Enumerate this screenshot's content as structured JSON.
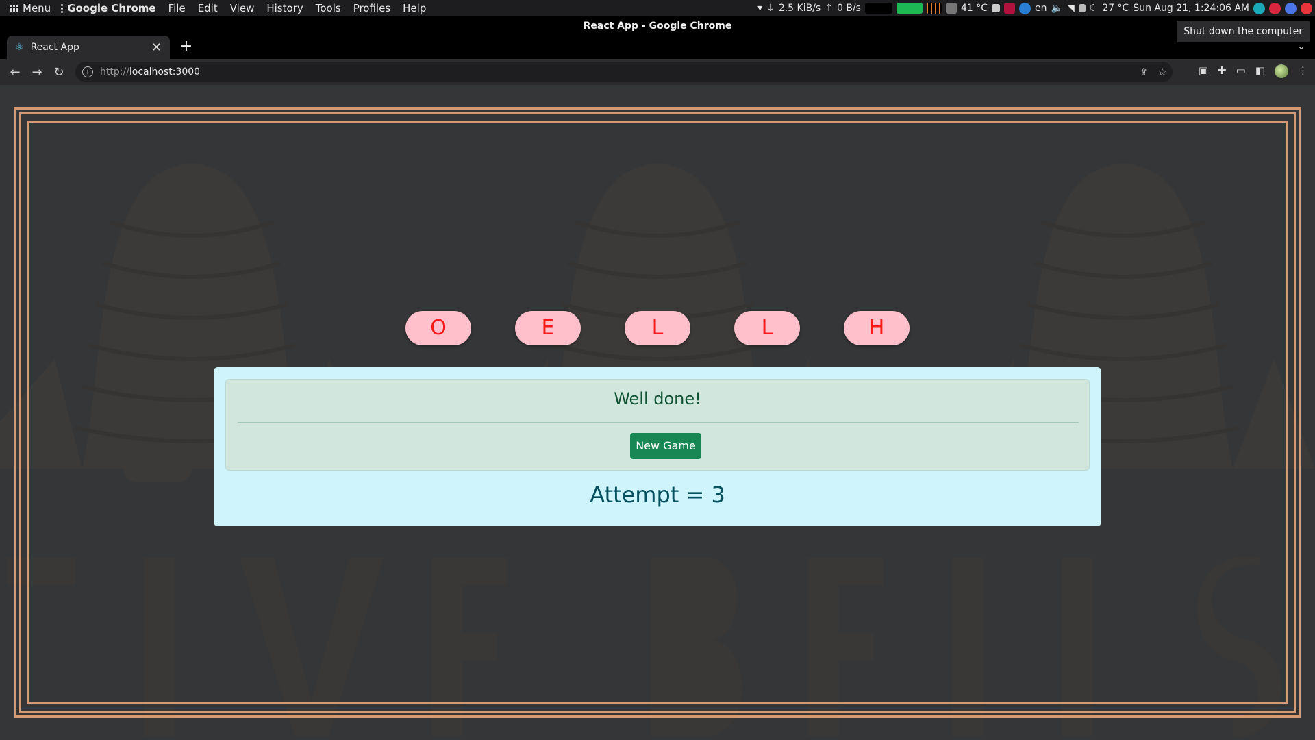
{
  "os_panel": {
    "menu_label": "Menu",
    "app_name": "Google Chrome",
    "menus": [
      "File",
      "Edit",
      "View",
      "History",
      "Tools",
      "Profiles",
      "Help"
    ],
    "net_down": "2.5 KiB/s",
    "net_up": "0 B/s",
    "cpu_temp": "41 °C",
    "keyboard_layout": "en",
    "weather_temp": "27 °C",
    "clock": "Sun Aug 21,  1:24:06 AM"
  },
  "tooltip": "Shut down the computer",
  "window_title": "React App - Google Chrome",
  "tab": {
    "title": "React App",
    "close_glyph": "✕",
    "new_tab_glyph": "+"
  },
  "address": {
    "scheme": "http://",
    "host": "localhost:3000"
  },
  "game": {
    "tiles": [
      "O",
      "E",
      "L",
      "L",
      "H"
    ],
    "message": "Well done!",
    "new_game_label": "New Game",
    "attempt_text": "Attempt = 3"
  },
  "colors": {
    "frame": "#d39a74",
    "tile_bg": "#ffc0cb",
    "tile_text": "#ff1a1a",
    "card_bg": "#cff4fc",
    "alert_bg": "#d1e7dd",
    "button": "#198754"
  },
  "icons": {
    "back": "arrow-left-icon",
    "forward": "arrow-right-icon",
    "reload": "reload-icon",
    "info": "info-icon",
    "share": "share-icon",
    "bookmark": "star-icon",
    "extensions": "puzzle-icon"
  }
}
